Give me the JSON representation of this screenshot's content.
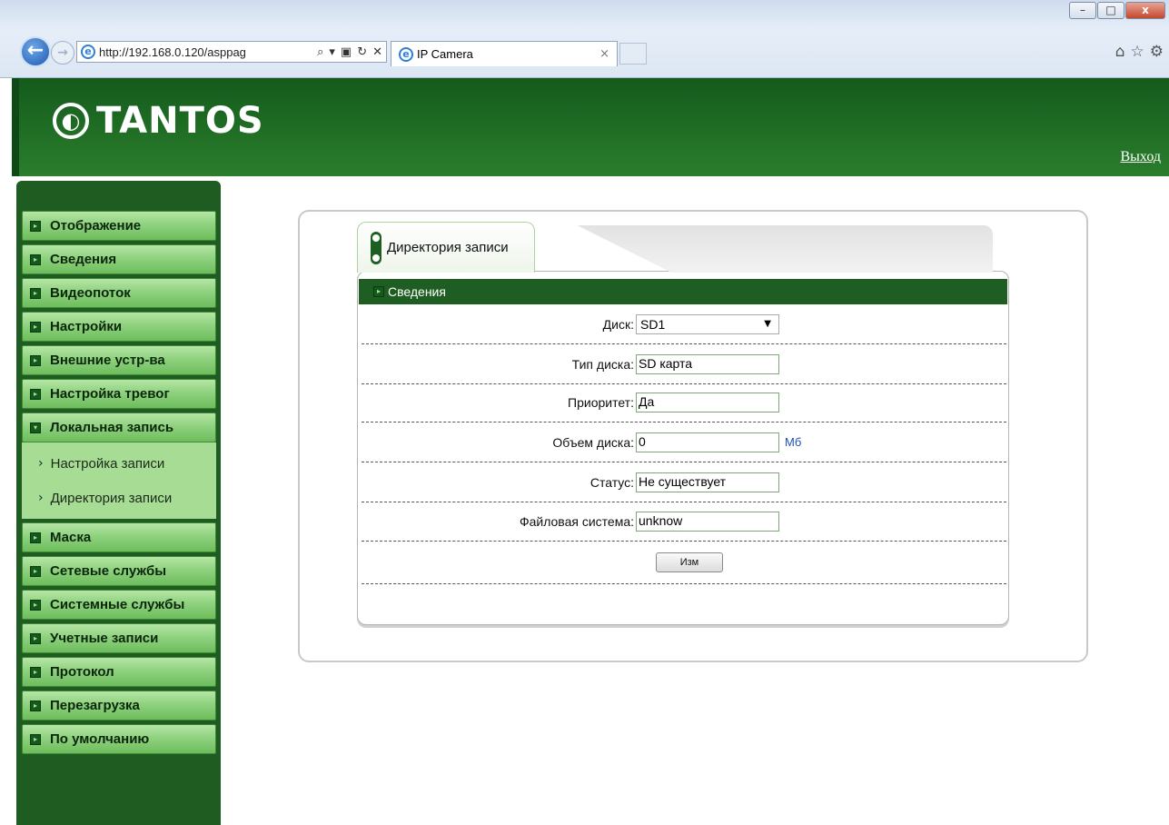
{
  "browser": {
    "address": "http://192.168.0.120/asppag",
    "tab_title": "IP Camera",
    "minimize": "–",
    "maximize": "□",
    "close": "x"
  },
  "header": {
    "logo": "TANTOS",
    "logout": "Выход"
  },
  "sidebar": {
    "items": [
      {
        "label": "Отображение"
      },
      {
        "label": "Сведения"
      },
      {
        "label": "Видеопоток"
      },
      {
        "label": "Настройки"
      },
      {
        "label": "Внешние устр-ва"
      },
      {
        "label": "Настройка тревог"
      },
      {
        "label": "Локальная запись"
      },
      {
        "label": "Маска"
      },
      {
        "label": "Сетевые службы"
      },
      {
        "label": "Системные службы"
      },
      {
        "label": "Учетные записи"
      },
      {
        "label": "Протокол"
      },
      {
        "label": "Перезагрузка"
      },
      {
        "label": "По умолчанию"
      }
    ],
    "subitems": [
      {
        "label": "Настройка записи"
      },
      {
        "label": "Директория записи"
      }
    ]
  },
  "panel": {
    "tab": "Директория записи",
    "section": "Сведения",
    "disk_label": "Диск:",
    "disk_value": "SD1",
    "type_label": "Тип диска:",
    "type_value": "SD карта",
    "priority_label": "Приоритет:",
    "priority_value": "Да",
    "size_label": "Объем диска:",
    "size_value": "0",
    "size_unit": "Мб",
    "status_label": "Статус:",
    "status_value": "Не существует",
    "fs_label": "Файловая система:",
    "fs_value": "unknow",
    "change_button": "Изм"
  },
  "colors": {
    "header_green": "#1e6b24",
    "sidebar_green": "#1e5c22",
    "menu_item": "#8fd27f",
    "unit_blue": "#2050b0"
  }
}
